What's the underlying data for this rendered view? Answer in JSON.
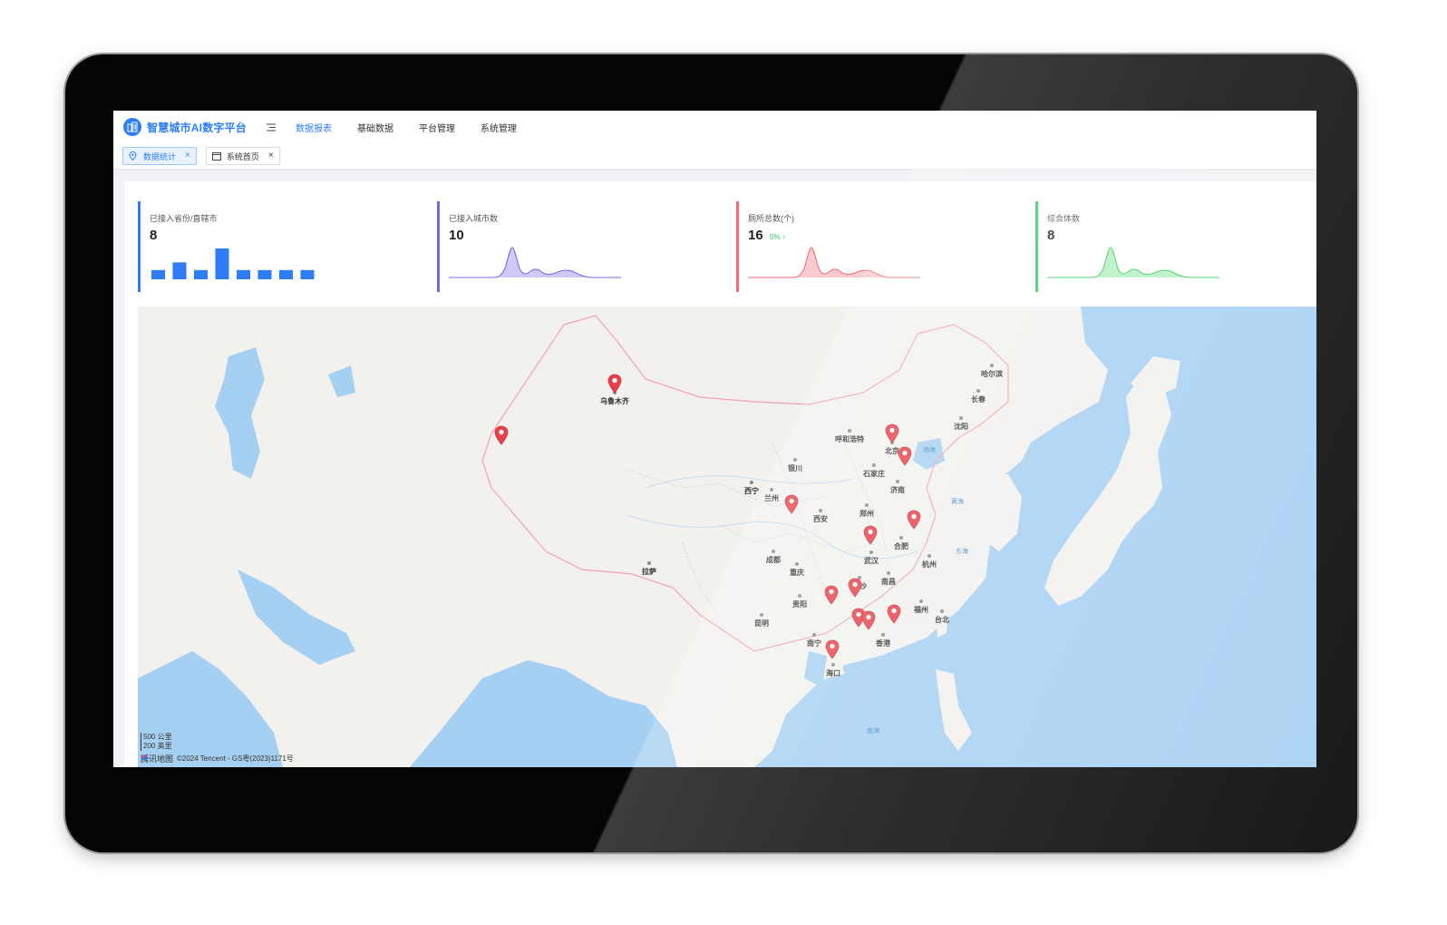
{
  "app": {
    "title": "智慧城市AI数字平台",
    "nav": [
      "数据报表",
      "基础数据",
      "平台管理",
      "系统管理"
    ],
    "nav_active_index": 0
  },
  "tabs": [
    {
      "label": "数据统计",
      "icon": "location-pin-icon",
      "active": true
    },
    {
      "label": "系统首页",
      "icon": "window-icon",
      "active": false
    }
  ],
  "stats": [
    {
      "label": "已接入省份/直辖市",
      "value": "8",
      "change": "",
      "color": "#2f7df6",
      "chart": "bar",
      "bars": [
        0.3,
        0.55,
        0.3,
        1.0,
        0.3,
        0.3,
        0.3,
        0.3
      ]
    },
    {
      "label": "已接入城市数",
      "value": "10",
      "change": "",
      "color": "#7b61e8",
      "chart": "wave"
    },
    {
      "label": "厕所总数(个)",
      "value": "16",
      "change": "0% ↑",
      "color": "#f06b73",
      "chart": "wave"
    },
    {
      "label": "综合体数",
      "value": "8",
      "change": "",
      "color": "#35d05a",
      "chart": "wave"
    }
  ],
  "map": {
    "cities": [
      {
        "name": "乌鲁木齐",
        "pin": true
      },
      {
        "name": "呼和浩特"
      },
      {
        "name": "北京",
        "pin": true
      },
      {
        "name": "哈尔滨"
      },
      {
        "name": "长春"
      },
      {
        "name": "沈阳"
      },
      {
        "name": "银川"
      },
      {
        "name": "石家庄"
      },
      {
        "name": "济南"
      },
      {
        "name": "西宁"
      },
      {
        "name": "兰州"
      },
      {
        "name": "西安"
      },
      {
        "name": "郑州"
      },
      {
        "name": "合肥"
      },
      {
        "name": "武汉"
      },
      {
        "name": "成都"
      },
      {
        "name": "重庆"
      },
      {
        "name": "杭州"
      },
      {
        "name": "拉萨"
      },
      {
        "name": "长沙"
      },
      {
        "name": "南昌"
      },
      {
        "name": "贵阳"
      },
      {
        "name": "福州"
      },
      {
        "name": "昆明"
      },
      {
        "name": "台北"
      },
      {
        "name": "南宁"
      },
      {
        "name": "香港"
      },
      {
        "name": "海口"
      }
    ],
    "seas": [
      "渤海",
      "黄海",
      "东海",
      "南海"
    ],
    "scale_km": "500 公里",
    "scale_mi": "200 英里",
    "attribution_brand": "腾讯地图",
    "attribution_text": "©2024 Tencent - GS粤(2023)1171号"
  }
}
